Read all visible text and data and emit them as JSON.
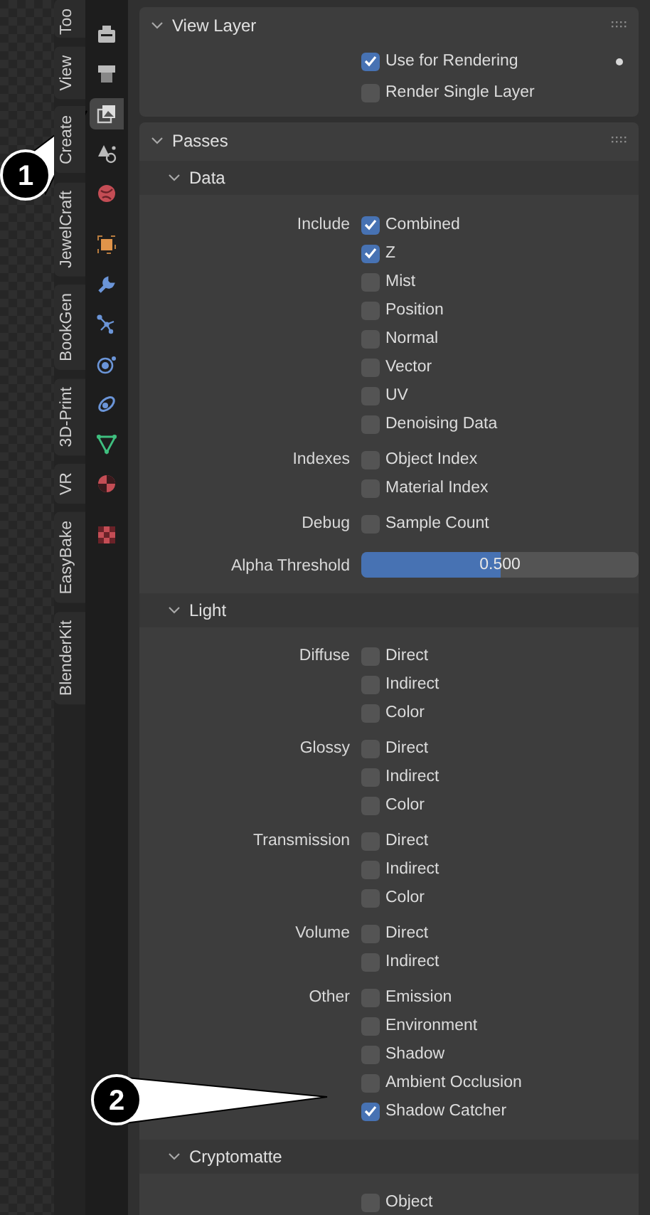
{
  "sidebar_tabs": [
    {
      "label": "Too",
      "selected": false
    },
    {
      "label": "View",
      "selected": false
    },
    {
      "label": "Create",
      "selected": false
    },
    {
      "label": "JewelCraft",
      "selected": false
    },
    {
      "label": "BookGen",
      "selected": false
    },
    {
      "label": "3D-Print",
      "selected": false
    },
    {
      "label": "VR",
      "selected": false
    },
    {
      "label": "EasyBake",
      "selected": false
    },
    {
      "label": "BlenderKit",
      "selected": false
    }
  ],
  "property_tabs": [
    {
      "kind": "tool",
      "selected": false
    },
    {
      "kind": "render",
      "selected": false
    },
    {
      "kind": "view_layer",
      "selected": true
    },
    {
      "kind": "scene",
      "selected": false
    },
    {
      "kind": "world",
      "selected": false
    },
    {
      "kind": "object",
      "selected": false
    },
    {
      "kind": "modifier",
      "selected": false
    },
    {
      "kind": "particles",
      "selected": false
    },
    {
      "kind": "physics",
      "selected": false
    },
    {
      "kind": "constraints",
      "selected": false
    },
    {
      "kind": "data",
      "selected": false
    },
    {
      "kind": "material",
      "selected": false
    },
    {
      "kind": "texture",
      "selected": false
    }
  ],
  "view_layer": {
    "title": "View Layer",
    "expanded": true,
    "options": [
      {
        "label": "Use for Rendering",
        "checked": true
      },
      {
        "label": "Render Single Layer",
        "checked": false
      }
    ]
  },
  "passes": {
    "title": "Passes",
    "expanded": true,
    "subpanels": [
      {
        "title": "Data",
        "expanded": true,
        "groups": [
          {
            "label": "Include",
            "options": [
              {
                "label": "Combined",
                "checked": true
              },
              {
                "label": "Z",
                "checked": true
              },
              {
                "label": "Mist",
                "checked": false
              },
              {
                "label": "Position",
                "checked": false
              },
              {
                "label": "Normal",
                "checked": false
              },
              {
                "label": "Vector",
                "checked": false
              },
              {
                "label": "UV",
                "checked": false
              },
              {
                "label": "Denoising Data",
                "checked": false
              }
            ]
          },
          {
            "label": "Indexes",
            "options": [
              {
                "label": "Object Index",
                "checked": false
              },
              {
                "label": "Material Index",
                "checked": false
              }
            ]
          },
          {
            "label": "Debug",
            "options": [
              {
                "label": "Sample Count",
                "checked": false
              }
            ]
          }
        ],
        "slider": {
          "label": "Alpha Threshold",
          "value": "0.500",
          "level": 0.5
        }
      },
      {
        "title": "Light",
        "expanded": true,
        "groups": [
          {
            "label": "Diffuse",
            "options": [
              {
                "label": "Direct",
                "checked": false
              },
              {
                "label": "Indirect",
                "checked": false
              },
              {
                "label": "Color",
                "checked": false
              }
            ]
          },
          {
            "label": "Glossy",
            "options": [
              {
                "label": "Direct",
                "checked": false
              },
              {
                "label": "Indirect",
                "checked": false
              },
              {
                "label": "Color",
                "checked": false
              }
            ]
          },
          {
            "label": "Transmission",
            "options": [
              {
                "label": "Direct",
                "checked": false
              },
              {
                "label": "Indirect",
                "checked": false
              },
              {
                "label": "Color",
                "checked": false
              }
            ]
          },
          {
            "label": "Volume",
            "options": [
              {
                "label": "Direct",
                "checked": false
              },
              {
                "label": "Indirect",
                "checked": false
              }
            ]
          },
          {
            "label": "Other",
            "options": [
              {
                "label": "Emission",
                "checked": false
              },
              {
                "label": "Environment",
                "checked": false
              },
              {
                "label": "Shadow",
                "checked": false
              },
              {
                "label": "Ambient Occlusion",
                "checked": false
              },
              {
                "label": "Shadow Catcher",
                "checked": true
              }
            ]
          }
        ]
      },
      {
        "title": "Cryptomatte",
        "expanded": true,
        "groups": [
          {
            "options": [
              {
                "label": "Object",
                "checked": false
              }
            ]
          }
        ]
      }
    ]
  },
  "callouts": [
    {
      "label": "1"
    },
    {
      "label": "2"
    }
  ]
}
